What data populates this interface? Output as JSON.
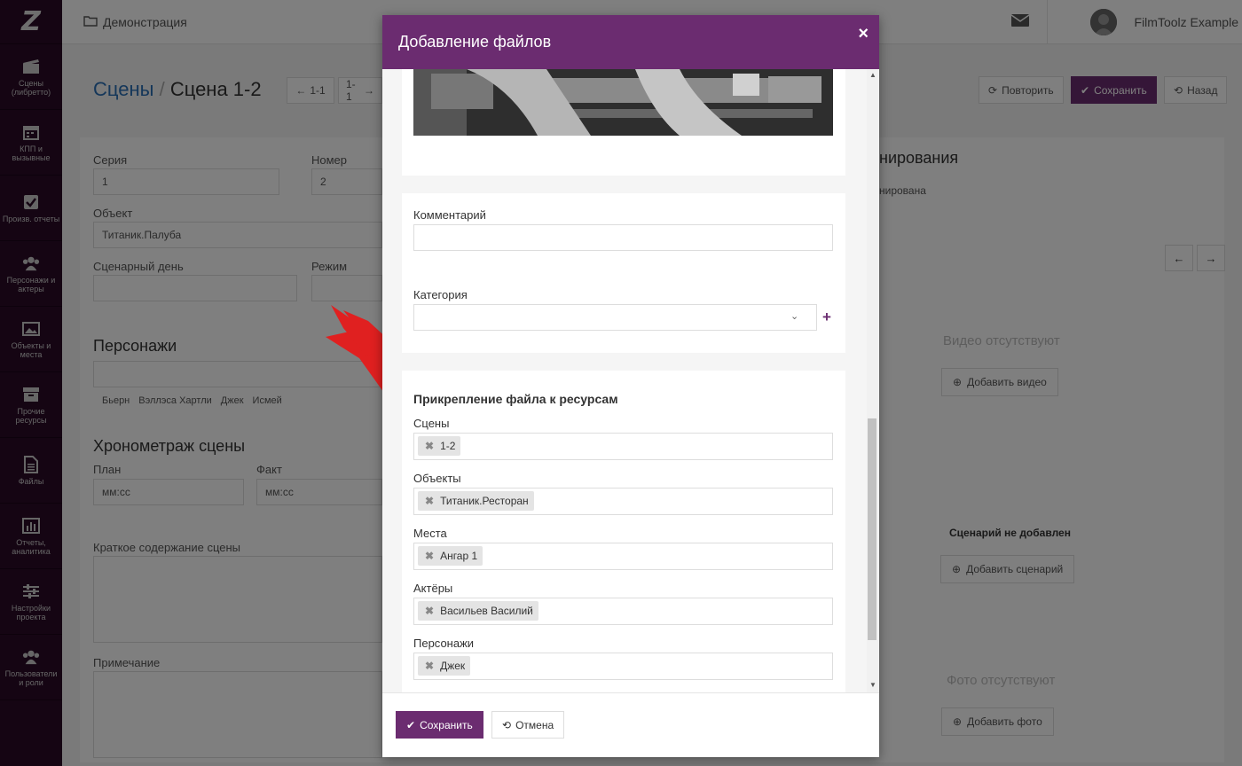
{
  "app": {
    "logo_letter": "Z",
    "breadcrumb": "Демонстрация",
    "user_name": "FilmToolz Example"
  },
  "sidebar": {
    "items": [
      {
        "label": "Сцены (либретто)",
        "icon": "clapperboard-icon"
      },
      {
        "label": "КПП и вызывные",
        "icon": "calendar-icon"
      },
      {
        "label": "Произв. отчеты",
        "icon": "checkbox-icon"
      },
      {
        "label": "Персонажи и актеры",
        "icon": "users-icon"
      },
      {
        "label": "Объекты и места",
        "icon": "image-icon"
      },
      {
        "label": "Прочие ресурсы",
        "icon": "archive-icon"
      },
      {
        "label": "Файлы",
        "icon": "file-icon"
      },
      {
        "label": "Отчеты, аналитика",
        "icon": "bar-chart-icon"
      },
      {
        "label": "Настройки проекта",
        "icon": "sliders-icon"
      },
      {
        "label": "Пользователи и роли",
        "icon": "users-group-icon"
      }
    ]
  },
  "page": {
    "title_section": "Сцены",
    "title_separator": "/",
    "title_scene": "Сцена 1-2",
    "prev_label": "1-1",
    "next_label": "1-1",
    "repeat_label": "Повторить",
    "save_label": "Сохранить",
    "back_label": "Назад",
    "series_label": "Серия",
    "series_value": "1",
    "number_label": "Номер",
    "number_value": "2",
    "object_label": "Объект",
    "object_value": "Титаник.Палуба",
    "script_day_label": "Сценарный день",
    "mode_label": "Режим",
    "characters_title": "Персонажи",
    "characters": [
      "Бьерн",
      "Вэллэса Хартли",
      "Джек",
      "Исмей"
    ],
    "timing_title": "Хронометраж сцены",
    "plan_label": "План",
    "fact_label": "Факт",
    "time_placeholder": "мм:сс",
    "summary_label": "Краткое содержание сцены",
    "note_label": "Примечание",
    "planning_title": "нирования",
    "planning_status": "нирована",
    "no_video": "Видео отсутствуют",
    "add_video": "Добавить видео",
    "no_script": "Сценарий не добавлен",
    "add_script": "Добавить сценарий",
    "no_photo": "Фото отсутствуют",
    "add_photo": "Добавить фото"
  },
  "modal": {
    "title": "Добавление файлов",
    "comment_label": "Комментарий",
    "comment_value": "",
    "category_label": "Категория",
    "category_value": "",
    "attach_title": "Прикрепление файла к ресурсам",
    "fields": [
      {
        "label": "Сцены",
        "chips": [
          "1-2"
        ]
      },
      {
        "label": "Объекты",
        "chips": [
          "Титаник.Ресторан"
        ]
      },
      {
        "label": "Места",
        "chips": [
          "Ангар 1"
        ]
      },
      {
        "label": "Актёры",
        "chips": [
          "Васильев Василий"
        ]
      },
      {
        "label": "Персонажи",
        "chips": [
          "Джек"
        ]
      }
    ],
    "save_label": "Сохранить",
    "cancel_label": "Отмена"
  },
  "colors": {
    "brand": "#6b2c70",
    "sidebar": "#2b0a27",
    "link": "#2a6fb4",
    "arrow": "#e02020"
  }
}
